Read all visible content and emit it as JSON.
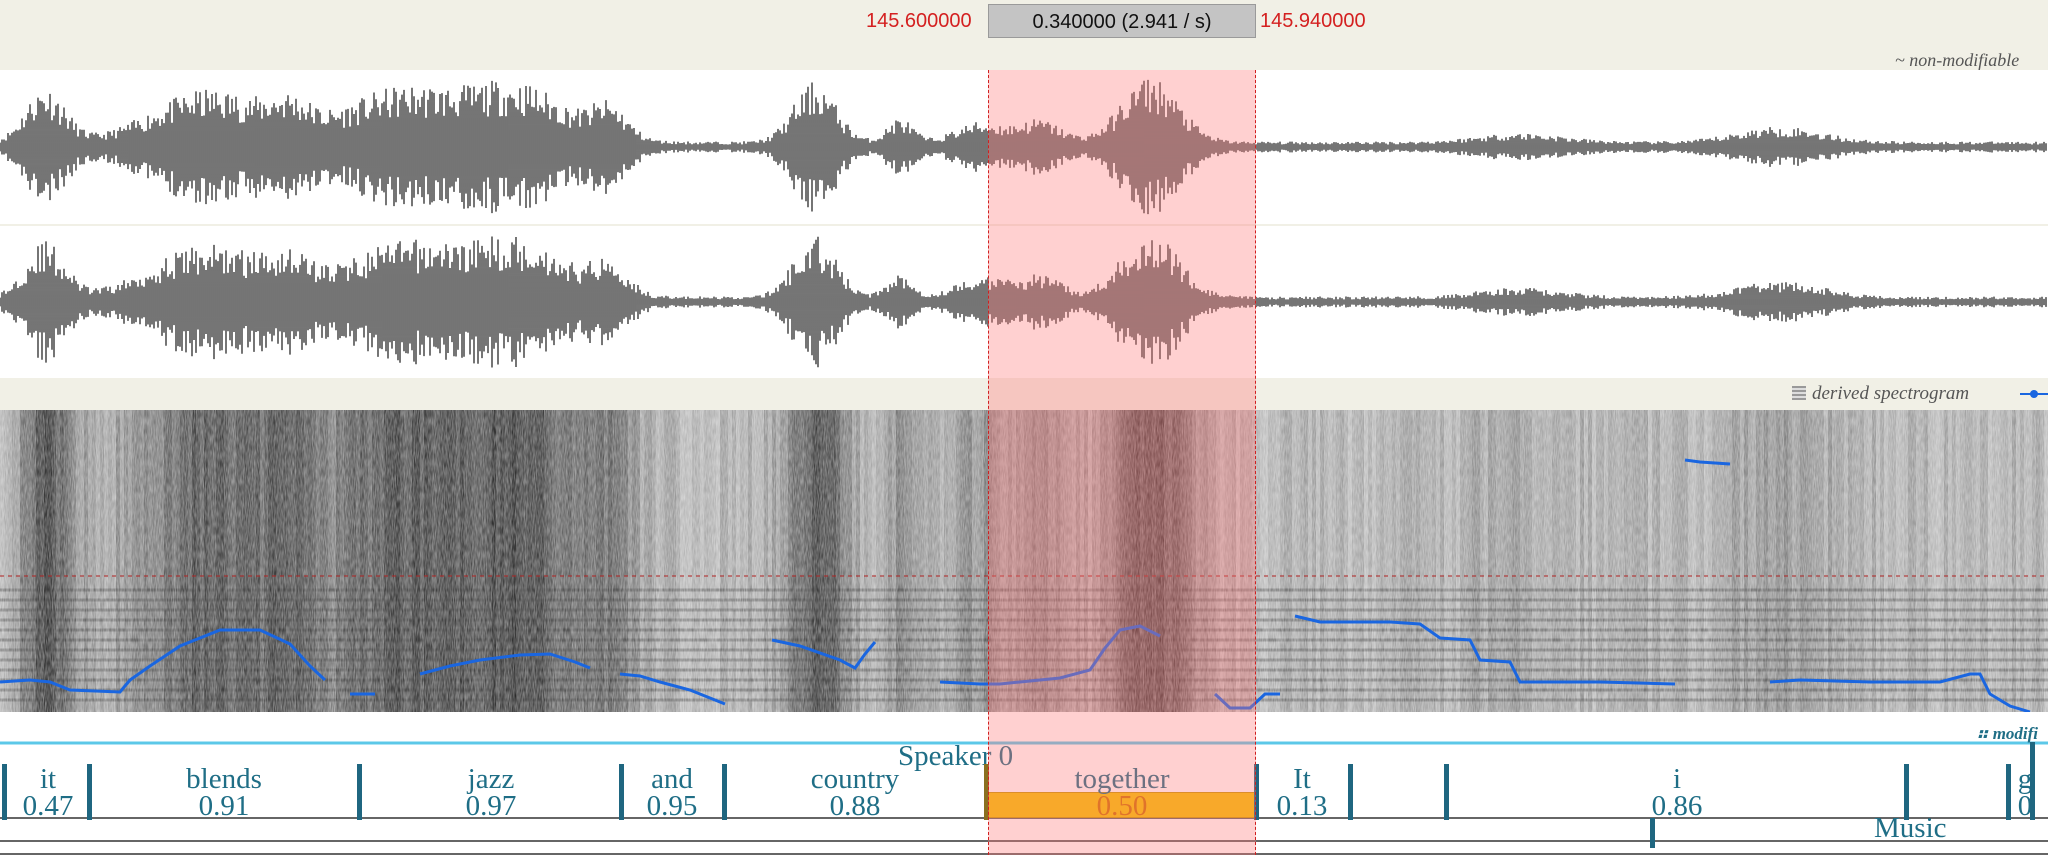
{
  "ruler": {
    "sel_start": "145.600000",
    "sel_length": "0.340000 (2.941 / s)",
    "sel_end": "145.940000"
  },
  "wave_tag": "~ non-modifiable",
  "spectrogram_tag": "derived spectrogram",
  "transcript_tag": "modifi",
  "speaker": "Speaker 0",
  "music_label": "Music",
  "colors": {
    "pitch": "#1a66e0",
    "selection": "#ffb4b4",
    "tier": "#1f6e86",
    "highlight": "#f5c400"
  },
  "words": [
    {
      "word": "it",
      "conf": "0.47"
    },
    {
      "word": "blends",
      "conf": "0.91"
    },
    {
      "word": "jazz",
      "conf": "0.97"
    },
    {
      "word": "and",
      "conf": "0.95"
    },
    {
      "word": "country",
      "conf": "0.88"
    },
    {
      "word": "together",
      "conf": "0.50"
    },
    {
      "word": "It",
      "conf": "0.13"
    },
    {
      "word": "",
      "conf": ""
    },
    {
      "word": "i",
      "conf": "0.86"
    },
    {
      "word": "g",
      "conf": "0"
    }
  ]
}
